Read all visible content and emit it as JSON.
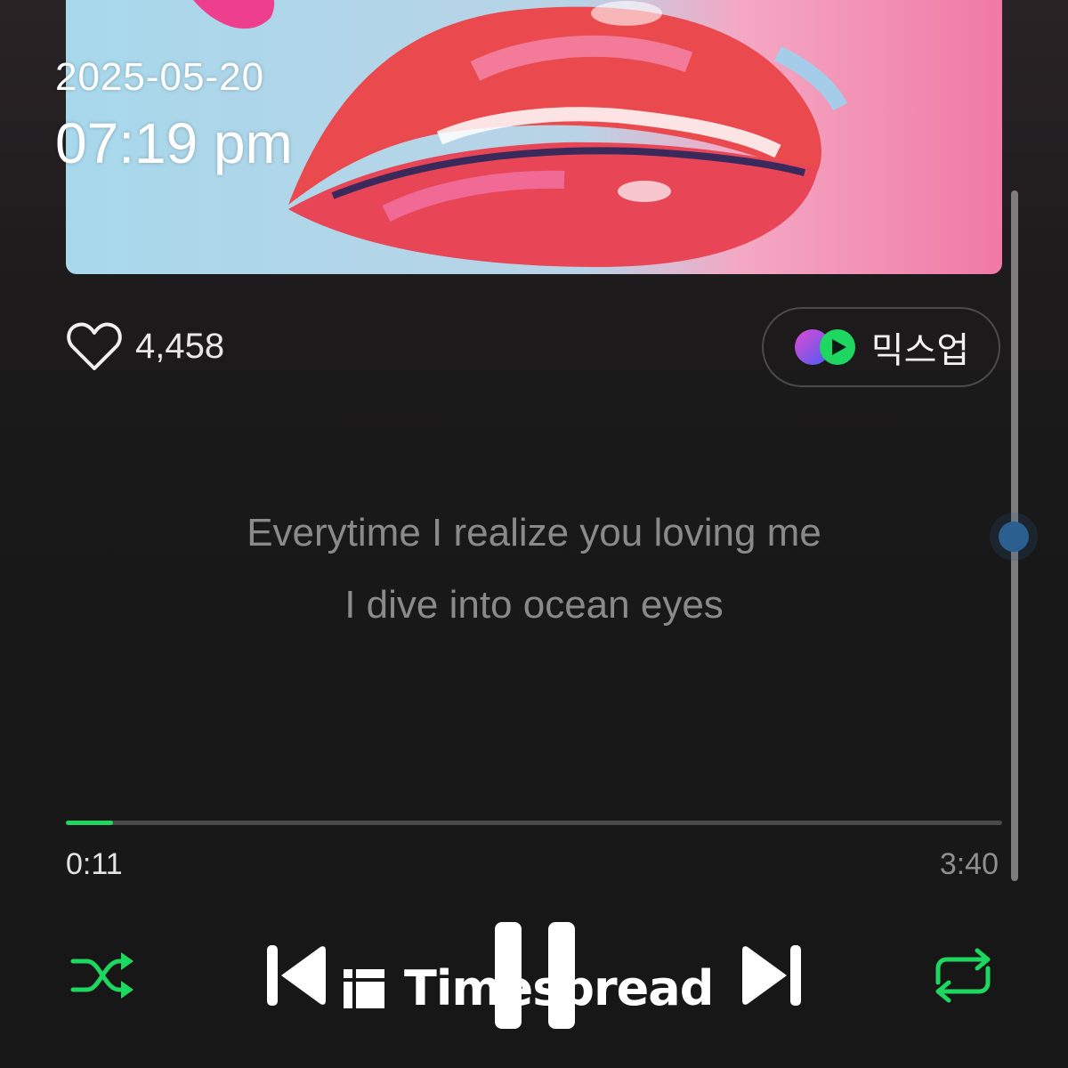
{
  "timestamp": {
    "date": "2025-05-20",
    "time": "07:19 pm"
  },
  "album_art": {
    "description_icon": "album-art-image"
  },
  "like": {
    "icon": "heart-outline-icon",
    "count": "4,458"
  },
  "mixup": {
    "icon": "mixup-icon",
    "label": "믹스업",
    "icon_colors": [
      "#6c4df5",
      "#1ed760"
    ]
  },
  "lyrics": {
    "lines": [
      "Everytime I realize you loving me",
      "I dive into ocean eyes"
    ]
  },
  "playback": {
    "current": "0:11",
    "duration": "3:40",
    "progress_fraction": 0.05,
    "accent_color": "#1ed760"
  },
  "controls": {
    "shuffle": "shuffle-icon",
    "previous": "skip-previous-icon",
    "pause": "pause-icon",
    "next": "skip-next-icon",
    "repeat": "repeat-icon"
  },
  "watermark": {
    "text": "Timespread"
  }
}
